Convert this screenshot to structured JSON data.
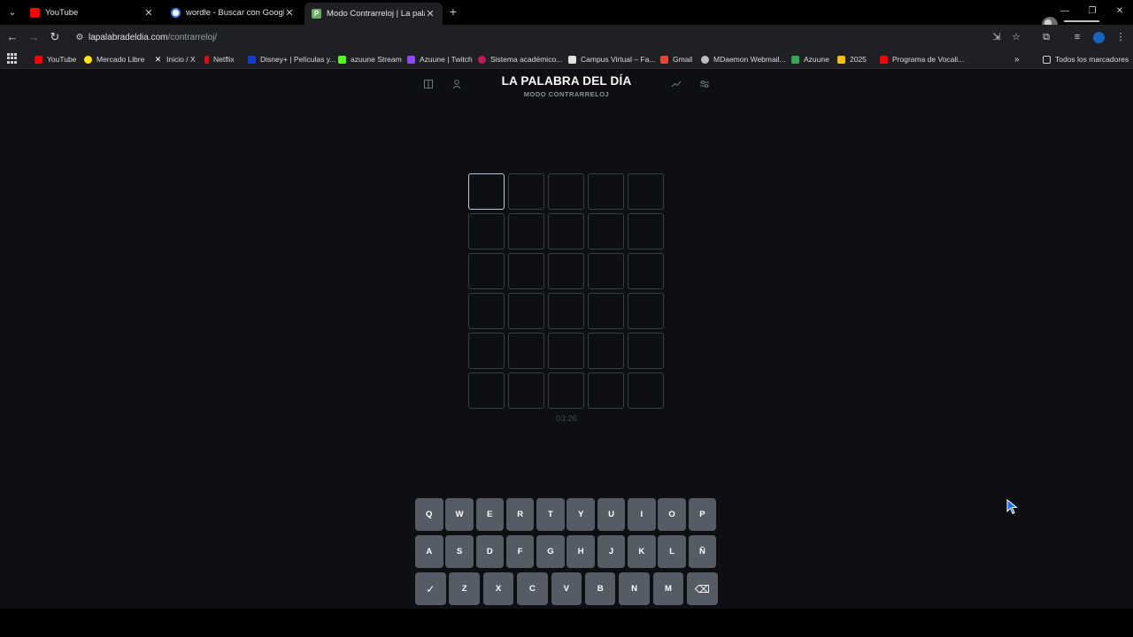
{
  "browser": {
    "tabs": [
      {
        "title": "YouTube",
        "color": "#ff0000",
        "active": false
      },
      {
        "title": "wordle - Buscar con Google",
        "color": "#4285f4",
        "active": false
      },
      {
        "title": "Modo Contrarreloj | La palabra",
        "color": "#6aaa64",
        "active": true
      }
    ],
    "url_host": "lapalabradeldia.com",
    "url_path": "/contrarreloj/",
    "bookmarks": [
      {
        "label": "YouTube",
        "color": "#ff0000"
      },
      {
        "label": "Mercado Libre",
        "color": "#ffe600"
      },
      {
        "label": "Inicio / X",
        "color": "#ffffff"
      },
      {
        "label": "Netflix",
        "color": "#e50914"
      },
      {
        "label": "Disney+ | Películas y...",
        "color": "#113ccf"
      },
      {
        "label": "azuune Stream",
        "color": "#53fc18"
      },
      {
        "label": "Azuune | Twitch",
        "color": "#9146ff"
      },
      {
        "label": "Sistema académico...",
        "color": "#c2185b"
      },
      {
        "label": "Campus Virtual – Fa...",
        "color": "#e0e0e0"
      },
      {
        "label": "Gmail",
        "color": "#ea4335"
      },
      {
        "label": "MDaemon Webmail...",
        "color": "#bdbdbd"
      },
      {
        "label": "Azuune",
        "color": "#34a853"
      },
      {
        "label": "2025",
        "color": "#fbbc04"
      },
      {
        "label": "Programa de Vocali...",
        "color": "#ff0000"
      }
    ],
    "all_bookmarks_label": "Todos los marcadores"
  },
  "game": {
    "title": "LA PALABRA DEL DÍA",
    "subtitle": "MODO CONTRARRELOJ",
    "timer": "03:26",
    "rows": 6,
    "cols": 5,
    "active_cell": [
      0,
      0
    ],
    "keyboard": {
      "row1": [
        "Q",
        "W",
        "E",
        "R",
        "T",
        "Y",
        "U",
        "I",
        "O",
        "P"
      ],
      "row2": [
        "A",
        "S",
        "D",
        "F",
        "G",
        "H",
        "J",
        "K",
        "L",
        "Ñ"
      ],
      "row3": [
        "✓",
        "Z",
        "X",
        "C",
        "V",
        "B",
        "N",
        "M",
        "⌫"
      ]
    },
    "colors": {
      "key_bg": "#565c66",
      "cell_border": "#3a3d44",
      "active_border": "#b9c8dc"
    }
  }
}
